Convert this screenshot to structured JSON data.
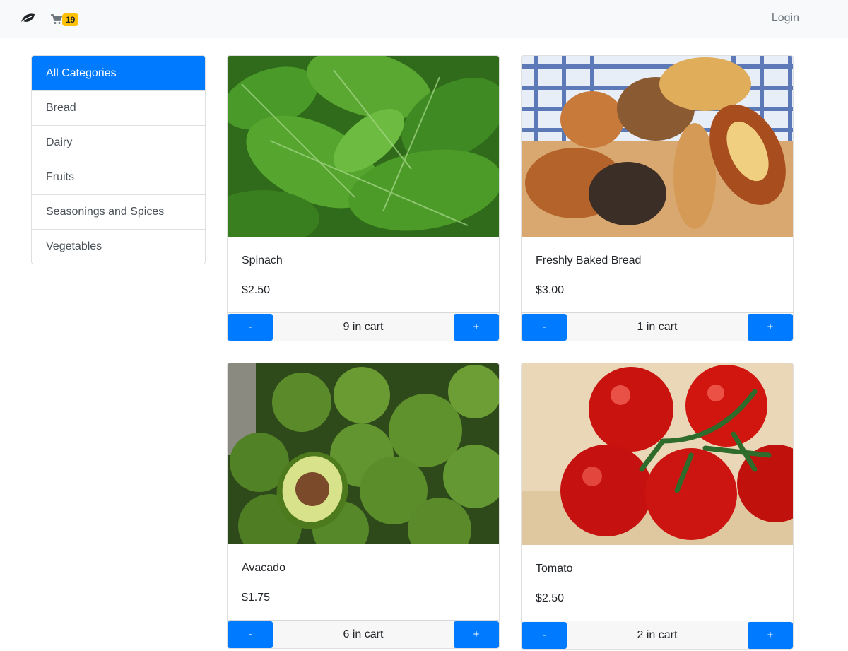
{
  "navbar": {
    "brand_icon": "leaf-icon",
    "cart_icon": "shopping-cart-icon",
    "cart_count": "19",
    "login_label": "Login"
  },
  "categories": [
    {
      "label": "All Categories",
      "active": true
    },
    {
      "label": "Bread",
      "active": false
    },
    {
      "label": "Dairy",
      "active": false
    },
    {
      "label": "Fruits",
      "active": false
    },
    {
      "label": "Seasonings and Spices",
      "active": false
    },
    {
      "label": "Vegetables",
      "active": false
    }
  ],
  "products": [
    {
      "name": "Spinach",
      "price": "$2.50",
      "cart": "9 in cart",
      "minus": "-",
      "plus": "+",
      "image": "spinach-photo"
    },
    {
      "name": "Freshly Baked Bread",
      "price": "$3.00",
      "cart": "1 in cart",
      "minus": "-",
      "plus": "+",
      "image": "bread-photo"
    },
    {
      "name": "Avacado",
      "price": "$1.75",
      "cart": "6 in cart",
      "minus": "-",
      "plus": "+",
      "image": "avocado-photo"
    },
    {
      "name": "Tomato",
      "price": "$2.50",
      "cart": "2 in cart",
      "minus": "-",
      "plus": "+",
      "image": "tomato-photo"
    }
  ],
  "colors": {
    "primary": "#007bff",
    "badge": "#ffc107",
    "navbar_bg": "#f8f9fa"
  }
}
